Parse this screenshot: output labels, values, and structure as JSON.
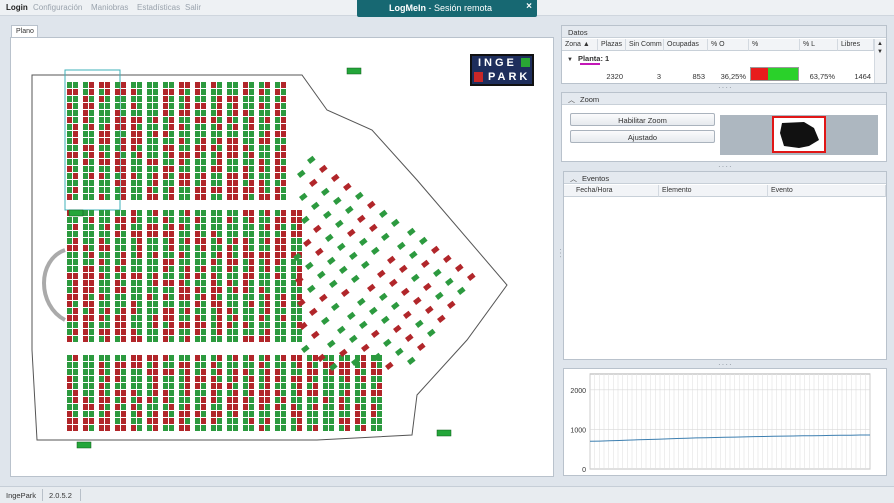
{
  "menu": {
    "items": [
      "Login",
      "Configuración",
      "Maniobras",
      "Estadísticas",
      "Salir"
    ]
  },
  "logmein": {
    "brand": "LogMeIn",
    "separator": " - ",
    "title": "Sesión remota",
    "close": "×"
  },
  "plan": {
    "tab_label": "Plano",
    "logo": {
      "line1": "INGE",
      "line2": "PARK"
    },
    "colors": {
      "occupied": "#b1262a",
      "free": "#2c9a3f",
      "lines": "#555555",
      "road": "#aaaaaa"
    }
  },
  "datos": {
    "title": "Datos",
    "columns": [
      "Zona",
      "Plazas",
      "Sin Comm",
      "Ocupadas",
      "% O",
      "%",
      "% L",
      "Libres"
    ],
    "group": "Planta: 1",
    "row": {
      "plazas": "2320",
      "sin_comm": "3",
      "ocupadas": "853",
      "pct_o": "36,25%",
      "pct_l": "63,75%",
      "libres": "1464"
    },
    "bar": {
      "occupied_fraction": 0.3625,
      "occupied_color": "#e81c1c",
      "free_color": "#2ad12a"
    }
  },
  "zoom": {
    "title": "Zoom",
    "enable_label": "Habilitar Zoom",
    "fit_label": "Ajustado"
  },
  "eventos": {
    "title": "Eventos",
    "columns": [
      "Fecha/Hora",
      "Elemento",
      "Evento"
    ]
  },
  "trend_chart": {
    "yticks": [
      "2000",
      "1000",
      "0"
    ],
    "ylim": [
      0,
      2400
    ],
    "line_color": "#3d7fb0",
    "values": [
      700,
      705,
      712,
      720,
      730,
      738,
      745,
      752,
      760,
      770,
      778,
      785,
      790,
      795,
      800,
      806,
      812,
      818,
      822,
      826,
      830,
      834,
      838,
      842,
      845,
      848,
      852,
      855,
      858,
      860
    ]
  },
  "status": {
    "app": "IngePark",
    "version": "2.0.5.2"
  }
}
